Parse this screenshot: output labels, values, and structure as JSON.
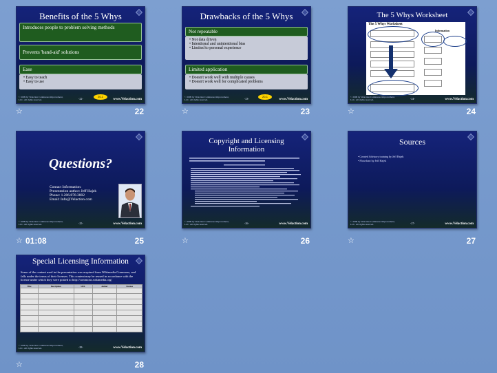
{
  "slides": [
    {
      "title": "Benefits of the 5 Whys",
      "number": "22",
      "footer": "© 2009 by Velaction Continuous Improvement, LLC. All rights reserved.",
      "page": "-22-",
      "site": "www.Velaction.com",
      "badge": "20-1",
      "bars": [
        "Introduces people to problem solving methods",
        "Prevents 'band-aid' solutions",
        "Ease"
      ],
      "ease_items": [
        "Easy to teach",
        "Easy to use"
      ]
    },
    {
      "title": "Drawbacks of the 5 Whys",
      "number": "23",
      "footer": "© 2009 by Velaction Continuous Improvement, LLC. All rights reserved.",
      "page": "-23-",
      "site": "www.Velaction.com",
      "badge": "20-1",
      "bar1": "Not repeatable",
      "bar1_items": [
        "Not data driven",
        "Intentional and unintentional bias",
        "Limited to personal experience"
      ],
      "bar2": "Limited application",
      "bar2_items": [
        "Doesn't work well with multiple causes",
        "Doesn't work well for complicated problems"
      ]
    },
    {
      "title": "The 5 Whys Worksheet",
      "number": "24",
      "footer": "© 2009 by Velaction Continuous Improvement, LLC. All rights reserved.",
      "page": "-24-",
      "site": "www.Velaction.com",
      "ws_title": "The 5 Whys Worksheet",
      "ws_info": "Information"
    },
    {
      "title": "Questions?",
      "number": "25",
      "time": "01:08",
      "footer": "© 2009 by Velaction Continuous Improvement, LLC. All rights reserved.",
      "page": "-25-",
      "site": "www.Velaction.com",
      "contact_1": "Contact Information:",
      "contact_2": "Presentation author: Jeff Hajek",
      "contact_3": "Phone: 1.206.870.3802",
      "contact_4": "Email: Info@Velaction.com"
    },
    {
      "title": "Copyright and Licensing Information",
      "number": "26",
      "footer": "© 2009 by Velaction Continuous Improvement, LLC. All rights reserved.",
      "page": "-26-",
      "site": "www.Velaction.com"
    },
    {
      "title": "Sources",
      "number": "27",
      "footer": "© 2009 by Velaction Continuous Improvement, LLC. All rights reserved.",
      "page": "-27-",
      "site": "www.Velaction.com",
      "items": [
        "Created Advisory training by Jeff Hajek",
        "Flowchart by Jeff Hajek"
      ]
    },
    {
      "title": "Special Licensing Information",
      "number": "28",
      "footer": "© 2009 by Velaction Continuous Improvement, LLC. All rights reserved.",
      "page": "-28-",
      "site": "www.Velaction.com",
      "intro": "Some of the content used in the presentation was acquired from Wikimedia Commons, and falls under the terms of their licenses. This content may be reused in accordance with the license under which they were posted to http://commons.wikimedia.org/",
      "columns": [
        "Title",
        "Description",
        "URL",
        "Author",
        "License"
      ]
    }
  ]
}
